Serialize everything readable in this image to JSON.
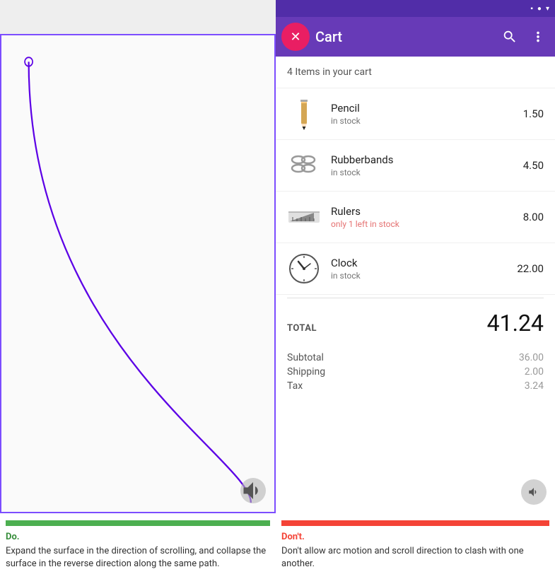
{
  "left": {
    "do_label": "Do.",
    "do_text": "Expand the surface in the direction of scrolling, and collapse the surface in the reverse direction along the same path.",
    "bar_color": "#4caf50"
  },
  "right": {
    "status_bar": {
      "icons": [
        "▪",
        "▪",
        "▾"
      ]
    },
    "header": {
      "avatar_icon": "✕",
      "title": "Cart",
      "search_icon": "🔍",
      "more_icon": "⋮"
    },
    "cart_header": "4 Items in your cart",
    "items": [
      {
        "name": "Pencil",
        "status": "in stock",
        "status_type": "normal",
        "price": "1.50"
      },
      {
        "name": "Rubberbands",
        "status": "in stock",
        "status_type": "normal",
        "price": "4.50"
      },
      {
        "name": "Rulers",
        "status": "only 1 left in stock",
        "status_type": "low",
        "price": "8.00"
      },
      {
        "name": "Clock",
        "status": "in stock",
        "status_type": "normal",
        "price": "22.00"
      }
    ],
    "total_label": "TOTAL",
    "total_amount": "41.24",
    "subtotal_label": "Subtotal",
    "subtotal_value": "36.00",
    "shipping_label": "Shipping",
    "shipping_value": "2.00",
    "tax_label": "Tax",
    "tax_value": "3.24",
    "dont_label": "Don't.",
    "dont_text": "Don't allow arc motion and scroll direction to clash with one another."
  }
}
